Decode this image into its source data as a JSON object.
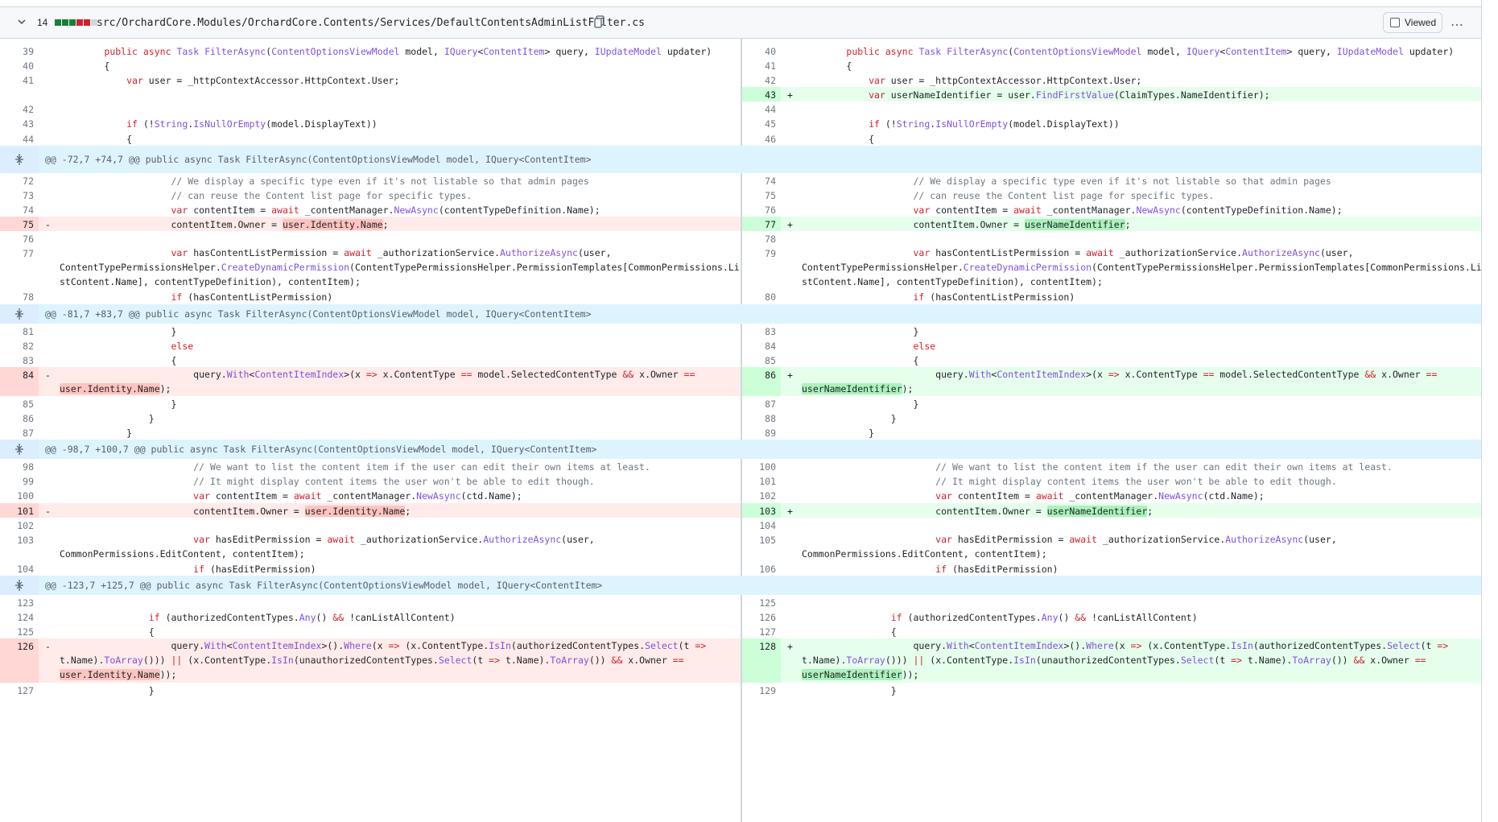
{
  "file": {
    "changes": "14",
    "path": "src/OrchardCore.Modules/OrchardCore.Contents/Services/DefaultContentsAdminListFilter.cs",
    "viewed_label": "Viewed",
    "more_label": "…",
    "blocks": [
      "#1a7f37",
      "#1a7f37",
      "#1a7f37",
      "#cf222e",
      "#cf222e",
      "#d0d7de"
    ]
  },
  "rows": [
    {
      "type": "spacer",
      "h": 6
    },
    {
      "type": "pair",
      "l": {
        "n": "39",
        "kind": "ctx",
        "t": "        public async Task FilterAsync(ContentOptionsViewModel model, IQuery<ContentItem> query, IUpdateModel updater)"
      },
      "r": {
        "n": "40",
        "kind": "ctx",
        "t": "        public async Task FilterAsync(ContentOptionsViewModel model, IQuery<ContentItem> query, IUpdateModel updater)"
      }
    },
    {
      "type": "pair",
      "l": {
        "n": "40",
        "kind": "ctx",
        "t": "        {"
      },
      "r": {
        "n": "41",
        "kind": "ctx",
        "t": "        {"
      }
    },
    {
      "type": "pair",
      "l": {
        "n": "41",
        "kind": "ctx",
        "t": "            var user = _httpContextAccessor.HttpContext.User;"
      },
      "r": {
        "n": "42",
        "kind": "ctx",
        "t": "            var user = _httpContextAccessor.HttpContext.User;"
      }
    },
    {
      "type": "pair",
      "l": {
        "n": "",
        "kind": "empty",
        "t": ""
      },
      "r": {
        "n": "43",
        "kind": "add",
        "t": "            var userNameIdentifier = user.FindFirstValue(ClaimTypes.NameIdentifier);"
      }
    },
    {
      "type": "pair",
      "l": {
        "n": "42",
        "kind": "ctx",
        "t": ""
      },
      "r": {
        "n": "44",
        "kind": "ctx",
        "t": ""
      }
    },
    {
      "type": "pair",
      "l": {
        "n": "43",
        "kind": "ctx",
        "t": "            if (!String.IsNullOrEmpty(model.DisplayText))"
      },
      "r": {
        "n": "45",
        "kind": "ctx",
        "t": "            if (!String.IsNullOrEmpty(model.DisplayText))"
      }
    },
    {
      "type": "pair",
      "l": {
        "n": "44",
        "kind": "ctx",
        "t": "            {"
      },
      "r": {
        "n": "46",
        "kind": "ctx",
        "t": "            {"
      }
    },
    {
      "type": "hunk",
      "t": "@@ -72,7 +74,7 @@ public async Task FilterAsync(ContentOptionsViewModel model, IQuery<ContentItem>",
      "h": 34
    },
    {
      "type": "pair",
      "l": {
        "n": "72",
        "kind": "ctx",
        "t": "                    // We display a specific type even if it's not listable so that admin pages"
      },
      "r": {
        "n": "74",
        "kind": "ctx",
        "t": "                    // We display a specific type even if it's not listable so that admin pages"
      }
    },
    {
      "type": "pair",
      "l": {
        "n": "73",
        "kind": "ctx",
        "t": "                    // can reuse the Content list page for specific types."
      },
      "r": {
        "n": "75",
        "kind": "ctx",
        "t": "                    // can reuse the Content list page for specific types."
      }
    },
    {
      "type": "pair",
      "l": {
        "n": "74",
        "kind": "ctx",
        "t": "                    var contentItem = await _contentManager.NewAsync(contentTypeDefinition.Name);"
      },
      "r": {
        "n": "76",
        "kind": "ctx",
        "t": "                    var contentItem = await _contentManager.NewAsync(contentTypeDefinition.Name);"
      }
    },
    {
      "type": "pair",
      "l": {
        "n": "75",
        "kind": "del",
        "t": "                    contentItem.Owner = user.Identity.Name;",
        "hl": "user.Identity.Name"
      },
      "r": {
        "n": "77",
        "kind": "add",
        "t": "                    contentItem.Owner = userNameIdentifier;",
        "hl": "userNameIdentifier"
      }
    },
    {
      "type": "pair",
      "l": {
        "n": "76",
        "kind": "ctx",
        "t": ""
      },
      "r": {
        "n": "78",
        "kind": "ctx",
        "t": ""
      }
    },
    {
      "type": "pair3",
      "l": {
        "n": "77",
        "kind": "ctx",
        "t": "                    var hasContentListPermission = await _authorizationService.AuthorizeAsync(user,\nContentTypePermissionsHelper.CreateDynamicPermission(ContentTypePermissionsHelper.PermissionTemplates[CommonPermissions.Li\nstContent.Name], contentTypeDefinition), contentItem);"
      },
      "r": {
        "n": "79",
        "kind": "ctx",
        "t": "                    var hasContentListPermission = await _authorizationService.AuthorizeAsync(user,\nContentTypePermissionsHelper.CreateDynamicPermission(ContentTypePermissionsHelper.PermissionTemplates[CommonPermissions.Li\nstContent.Name], contentTypeDefinition), contentItem);"
      }
    },
    {
      "type": "pair",
      "l": {
        "n": "78",
        "kind": "ctx",
        "t": "                    if (hasContentListPermission)"
      },
      "r": {
        "n": "80",
        "kind": "ctx",
        "t": "                    if (hasContentListPermission)"
      }
    },
    {
      "type": "hunk",
      "t": "@@ -81,7 +83,7 @@ public async Task FilterAsync(ContentOptionsViewModel model, IQuery<ContentItem>",
      "h": 24
    },
    {
      "type": "pair",
      "l": {
        "n": "81",
        "kind": "ctx",
        "t": "                    }"
      },
      "r": {
        "n": "83",
        "kind": "ctx",
        "t": "                    }"
      }
    },
    {
      "type": "pair",
      "l": {
        "n": "82",
        "kind": "ctx",
        "t": "                    else"
      },
      "r": {
        "n": "84",
        "kind": "ctx",
        "t": "                    else"
      }
    },
    {
      "type": "pair",
      "l": {
        "n": "83",
        "kind": "ctx",
        "t": "                    {"
      },
      "r": {
        "n": "85",
        "kind": "ctx",
        "t": "                    {"
      }
    },
    {
      "type": "pair2",
      "l": {
        "n": "84",
        "kind": "del",
        "t": "                        query.With<ContentItemIndex>(x => x.ContentType == model.SelectedContentType && x.Owner ==\nuser.Identity.Name);",
        "hl": "user.Identity.Name"
      },
      "r": {
        "n": "86",
        "kind": "add",
        "t": "                        query.With<ContentItemIndex>(x => x.ContentType == model.SelectedContentType && x.Owner ==\nuserNameIdentifier);",
        "hl": "userNameIdentifier"
      }
    },
    {
      "type": "pair",
      "l": {
        "n": "85",
        "kind": "ctx",
        "t": "                    }"
      },
      "r": {
        "n": "87",
        "kind": "ctx",
        "t": "                    }"
      }
    },
    {
      "type": "pair",
      "l": {
        "n": "86",
        "kind": "ctx",
        "t": "                }"
      },
      "r": {
        "n": "88",
        "kind": "ctx",
        "t": "                }"
      }
    },
    {
      "type": "pair",
      "l": {
        "n": "87",
        "kind": "ctx",
        "t": "            }"
      },
      "r": {
        "n": "89",
        "kind": "ctx",
        "t": "            }"
      }
    },
    {
      "type": "hunk",
      "t": "@@ -98,7 +100,7 @@ public async Task FilterAsync(ContentOptionsViewModel model, IQuery<ContentItem>",
      "h": 24
    },
    {
      "type": "pair",
      "l": {
        "n": "98",
        "kind": "ctx",
        "t": "                        // We want to list the content item if the user can edit their own items at least."
      },
      "r": {
        "n": "100",
        "kind": "ctx",
        "t": "                        // We want to list the content item if the user can edit their own items at least."
      }
    },
    {
      "type": "pair",
      "l": {
        "n": "99",
        "kind": "ctx",
        "t": "                        // It might display content items the user won't be able to edit though."
      },
      "r": {
        "n": "101",
        "kind": "ctx",
        "t": "                        // It might display content items the user won't be able to edit though."
      }
    },
    {
      "type": "pair",
      "l": {
        "n": "100",
        "kind": "ctx",
        "t": "                        var contentItem = await _contentManager.NewAsync(ctd.Name);"
      },
      "r": {
        "n": "102",
        "kind": "ctx",
        "t": "                        var contentItem = await _contentManager.NewAsync(ctd.Name);"
      }
    },
    {
      "type": "pair",
      "l": {
        "n": "101",
        "kind": "del",
        "t": "                        contentItem.Owner = user.Identity.Name;",
        "hl": "user.Identity.Name"
      },
      "r": {
        "n": "103",
        "kind": "add",
        "t": "                        contentItem.Owner = userNameIdentifier;",
        "hl": "userNameIdentifier"
      }
    },
    {
      "type": "pair",
      "l": {
        "n": "102",
        "kind": "ctx",
        "t": ""
      },
      "r": {
        "n": "104",
        "kind": "ctx",
        "t": ""
      }
    },
    {
      "type": "pair2",
      "l": {
        "n": "103",
        "kind": "ctx",
        "t": "                        var hasEditPermission = await _authorizationService.AuthorizeAsync(user,\nCommonPermissions.EditContent, contentItem);"
      },
      "r": {
        "n": "105",
        "kind": "ctx",
        "t": "                        var hasEditPermission = await _authorizationService.AuthorizeAsync(user,\nCommonPermissions.EditContent, contentItem);"
      }
    },
    {
      "type": "pair",
      "l": {
        "n": "104",
        "kind": "ctx",
        "t": "                        if (hasEditPermission)"
      },
      "r": {
        "n": "106",
        "kind": "ctx",
        "t": "                        if (hasEditPermission)"
      }
    },
    {
      "type": "hunk",
      "t": "@@ -123,7 +125,7 @@ public async Task FilterAsync(ContentOptionsViewModel model, IQuery<ContentItem>",
      "h": 24
    },
    {
      "type": "pair",
      "l": {
        "n": "123",
        "kind": "ctx",
        "t": ""
      },
      "r": {
        "n": "125",
        "kind": "ctx",
        "t": ""
      }
    },
    {
      "type": "pair",
      "l": {
        "n": "124",
        "kind": "ctx",
        "t": "                if (authorizedContentTypes.Any() && !canListAllContent)"
      },
      "r": {
        "n": "126",
        "kind": "ctx",
        "t": "                if (authorizedContentTypes.Any() && !canListAllContent)"
      }
    },
    {
      "type": "pair",
      "l": {
        "n": "125",
        "kind": "ctx",
        "t": "                {"
      },
      "r": {
        "n": "127",
        "kind": "ctx",
        "t": "                {"
      }
    },
    {
      "type": "pair3",
      "l": {
        "n": "126",
        "kind": "del",
        "t": "                    query.With<ContentItemIndex>().Where(x => (x.ContentType.IsIn(authorizedContentTypes.Select(t =>\nt.Name).ToArray())) || (x.ContentType.IsIn(unauthorizedContentTypes.Select(t => t.Name).ToArray()) && x.Owner ==\nuser.Identity.Name));",
        "hl": "user.Identity.Name"
      },
      "r": {
        "n": "128",
        "kind": "add",
        "t": "                    query.With<ContentItemIndex>().Where(x => (x.ContentType.IsIn(authorizedContentTypes.Select(t =>\nt.Name).ToArray())) || (x.ContentType.IsIn(unauthorizedContentTypes.Select(t => t.Name).ToArray()) && x.Owner ==\nuserNameIdentifier));",
        "hl": "userNameIdentifier"
      }
    },
    {
      "type": "pair",
      "l": {
        "n": "127",
        "kind": "ctx",
        "t": "                }"
      },
      "r": {
        "n": "129",
        "kind": "ctx",
        "t": "                }"
      }
    }
  ]
}
